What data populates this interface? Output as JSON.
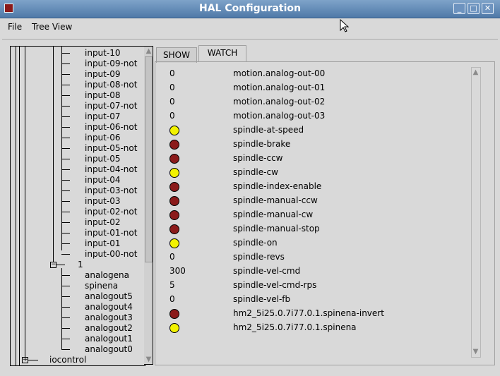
{
  "window": {
    "title": "HAL Configuration"
  },
  "titlebar_buttons": [
    "_",
    "□",
    "✕"
  ],
  "menu": [
    "File",
    "Tree View"
  ],
  "tree": {
    "top_items": [
      "input-10",
      "input-09-not",
      "input-09",
      "input-08-not",
      "input-08",
      "input-07-not",
      "input-07",
      "input-06-not",
      "input-06",
      "input-05-not",
      "input-05",
      "input-04-not",
      "input-04",
      "input-03-not",
      "input-03",
      "input-02-not",
      "input-02",
      "input-01-not",
      "input-01",
      "input-00-not"
    ],
    "group_label": "1",
    "group_items": [
      "analogena",
      "spinena",
      "analogout5",
      "analogout4",
      "analogout3",
      "analogout2",
      "analogout1",
      "analogout0"
    ],
    "bottom_item": "iocontrol",
    "expand_open": "−",
    "expand_closed": "+"
  },
  "tabs": [
    "SHOW",
    "WATCH"
  ],
  "watch_rows": [
    {
      "kind": "number",
      "value": "0",
      "name": "motion.analog-out-00"
    },
    {
      "kind": "number",
      "value": "0",
      "name": "motion.analog-out-01"
    },
    {
      "kind": "number",
      "value": "0",
      "name": "motion.analog-out-02"
    },
    {
      "kind": "number",
      "value": "0",
      "name": "motion.analog-out-03"
    },
    {
      "kind": "led",
      "state": "on",
      "name": "spindle-at-speed"
    },
    {
      "kind": "led",
      "state": "off",
      "name": "spindle-brake"
    },
    {
      "kind": "led",
      "state": "off",
      "name": "spindle-ccw"
    },
    {
      "kind": "led",
      "state": "on",
      "name": "spindle-cw"
    },
    {
      "kind": "led",
      "state": "off",
      "name": "spindle-index-enable"
    },
    {
      "kind": "led",
      "state": "off",
      "name": "spindle-manual-ccw"
    },
    {
      "kind": "led",
      "state": "off",
      "name": "spindle-manual-cw"
    },
    {
      "kind": "led",
      "state": "off",
      "name": "spindle-manual-stop"
    },
    {
      "kind": "led",
      "state": "on",
      "name": "spindle-on"
    },
    {
      "kind": "number",
      "value": "0",
      "name": "spindle-revs"
    },
    {
      "kind": "number",
      "value": "300",
      "name": "spindle-vel-cmd"
    },
    {
      "kind": "number",
      "value": "5",
      "name": "spindle-vel-cmd-rps"
    },
    {
      "kind": "number",
      "value": "0",
      "name": "spindle-vel-fb"
    },
    {
      "kind": "led",
      "state": "off",
      "name": "hm2_5i25.0.7i77.0.1.spinena-invert"
    },
    {
      "kind": "led",
      "state": "on",
      "name": "hm2_5i25.0.7i77.0.1.spinena"
    }
  ],
  "colors": {
    "led_on": "#f2f200",
    "led_off": "#8b1a1a"
  },
  "icons": {
    "scroll_up": "▲",
    "scroll_down": "▼"
  }
}
